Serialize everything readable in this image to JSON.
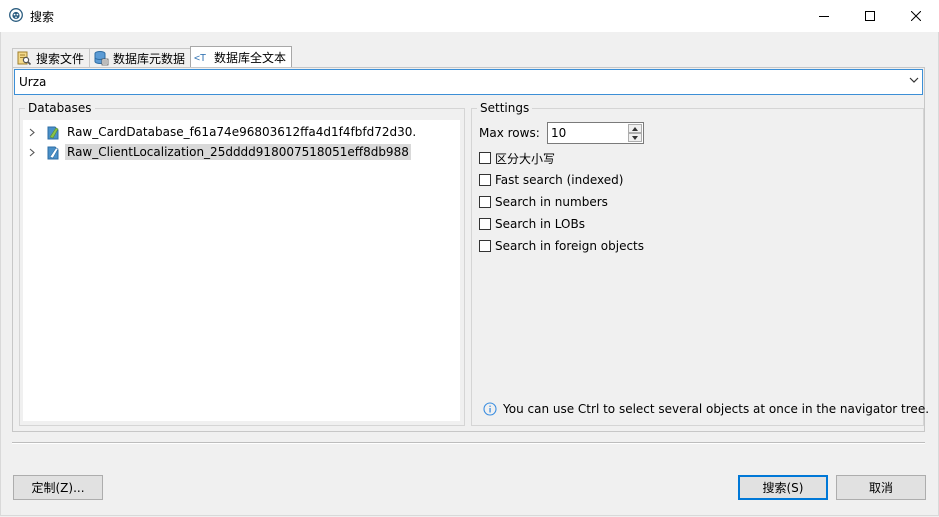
{
  "window": {
    "title": "搜索",
    "icon": "dbeaver-beaver-icon",
    "controls": [
      "minimize-icon",
      "maximize-icon",
      "close-icon"
    ]
  },
  "tabs": [
    {
      "label": "搜索文件",
      "icon": "search-files-icon",
      "active": false
    },
    {
      "label": "数据库元数据",
      "icon": "database-metadata-icon",
      "active": false
    },
    {
      "label": "数据库全文本",
      "icon": "fulltext-icon",
      "active": true
    }
  ],
  "search": {
    "value": "Urza"
  },
  "databases": {
    "title": "Databases",
    "items": [
      {
        "label": "Raw_CardDatabase_f61a74e96803612ffa4d1f4fbfd72d30.",
        "icon": "sqlite-database-icon",
        "selected": false
      },
      {
        "label": "Raw_ClientLocalization_25dddd918007518051eff8db988",
        "icon": "sqlite-database-icon",
        "selected": true
      }
    ]
  },
  "settings": {
    "title": "Settings",
    "max_rows_label": "Max rows:",
    "max_rows_value": "10",
    "options": [
      {
        "label": "区分大小写",
        "checked": false
      },
      {
        "label": "Fast search (indexed)",
        "checked": false
      },
      {
        "label": "Search in numbers",
        "checked": false
      },
      {
        "label": "Search in LOBs",
        "checked": false
      },
      {
        "label": "Search in foreign objects",
        "checked": false
      }
    ],
    "info": "You can use Ctrl to select several objects at once in the navigator tree."
  },
  "buttons": {
    "customize": "定制(Z)...",
    "search": "搜索(S)",
    "cancel": "取消"
  },
  "colors": {
    "accent": "#0078d7",
    "focus_border": "#3c8fd6",
    "selection": "#d9d9d9"
  }
}
